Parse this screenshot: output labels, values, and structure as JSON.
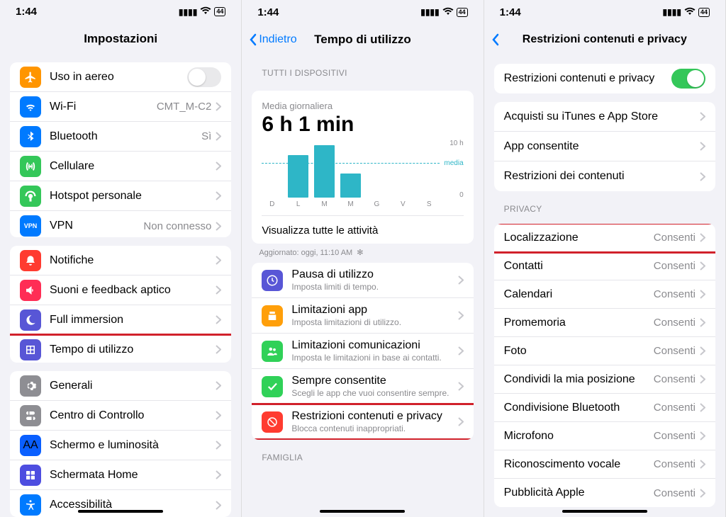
{
  "status": {
    "time": "1:44",
    "battery": "44"
  },
  "screen1": {
    "title": "Impostazioni",
    "g1": [
      {
        "name": "airplane",
        "label": "Uso in aereo",
        "color": "c-orange",
        "toggle": false
      },
      {
        "name": "wifi",
        "label": "Wi-Fi",
        "value": "CMT_M-C2",
        "color": "c-blue"
      },
      {
        "name": "bluetooth",
        "label": "Bluetooth",
        "value": "Sì",
        "color": "c-blue"
      },
      {
        "name": "cellular",
        "label": "Cellulare",
        "color": "c-green"
      },
      {
        "name": "hotspot",
        "label": "Hotspot personale",
        "color": "c-green"
      },
      {
        "name": "vpn",
        "label": "VPN",
        "value": "Non connesso",
        "color": "c-blue",
        "pill": "VPN"
      }
    ],
    "g2": [
      {
        "name": "notifications",
        "label": "Notifiche",
        "color": "c-red"
      },
      {
        "name": "sounds",
        "label": "Suoni e feedback aptico",
        "color": "c-pink"
      },
      {
        "name": "focus",
        "label": "Full immersion",
        "color": "c-indigo"
      },
      {
        "name": "screentime",
        "label": "Tempo di utilizzo",
        "color": "c-indigo",
        "highlight": true
      }
    ],
    "g3": [
      {
        "name": "general",
        "label": "Generali",
        "color": "c-gray"
      },
      {
        "name": "controlcenter",
        "label": "Centro di Controllo",
        "color": "c-gray"
      },
      {
        "name": "display",
        "label": "Schermo e luminosità",
        "color": "c-aa"
      },
      {
        "name": "homescreen",
        "label": "Schermata Home",
        "color": "c-grid"
      },
      {
        "name": "accessibility",
        "label": "Accessibilità",
        "color": "c-blue"
      }
    ]
  },
  "screen2": {
    "back": "Indietro",
    "title": "Tempo di utilizzo",
    "devices_header": "TUTTI I DISPOSITIVI",
    "avg_label": "Media giornaliera",
    "avg_value": "6 h 1 min",
    "view_all": "Visualizza tutte le attività",
    "updated": "Aggiornato: oggi, 11:10 AM",
    "items": [
      {
        "name": "downtime",
        "label": "Pausa di utilizzo",
        "sub": "Imposta limiti di tempo.",
        "color": "c-indigo"
      },
      {
        "name": "applimits",
        "label": "Limitazioni app",
        "sub": "Imposta limitazioni di utilizzo.",
        "color": "c-sand"
      },
      {
        "name": "commlimits",
        "label": "Limitazioni comunicazioni",
        "sub": "Imposta le limitazioni in base ai contatti.",
        "color": "c-green2"
      },
      {
        "name": "alwaysallowed",
        "label": "Sempre consentite",
        "sub": "Scegli le app che vuoi consentire sempre.",
        "color": "c-green2"
      },
      {
        "name": "restrictions",
        "label": "Restrizioni contenuti e privacy",
        "sub": "Blocca contenuti inappropriati.",
        "color": "c-red",
        "highlight": true
      }
    ],
    "family_header": "FAMIGLIA"
  },
  "screen3": {
    "title": "Restrizioni contenuti e privacy",
    "main_toggle_label": "Restrizioni contenuti e privacy",
    "g1": [
      {
        "name": "itunes",
        "label": "Acquisti su iTunes e App Store"
      },
      {
        "name": "allowedapps",
        "label": "App consentite"
      },
      {
        "name": "contentrestrict",
        "label": "Restrizioni dei contenuti"
      }
    ],
    "privacy_header": "PRIVACY",
    "g2": [
      {
        "name": "location",
        "label": "Localizzazione",
        "value": "Consenti",
        "highlight": true
      },
      {
        "name": "contacts",
        "label": "Contatti",
        "value": "Consenti"
      },
      {
        "name": "calendars",
        "label": "Calendari",
        "value": "Consenti"
      },
      {
        "name": "reminders",
        "label": "Promemoria",
        "value": "Consenti"
      },
      {
        "name": "photos",
        "label": "Foto",
        "value": "Consenti"
      },
      {
        "name": "sharelocation",
        "label": "Condividi la mia posizione",
        "value": "Consenti"
      },
      {
        "name": "btshare",
        "label": "Condivisione Bluetooth",
        "value": "Consenti"
      },
      {
        "name": "microphone",
        "label": "Microfono",
        "value": "Consenti"
      },
      {
        "name": "speech",
        "label": "Riconoscimento vocale",
        "value": "Consenti"
      },
      {
        "name": "appleads",
        "label": "Pubblicità Apple",
        "value": "Consenti"
      }
    ]
  },
  "chart_data": {
    "type": "bar",
    "categories": [
      "D",
      "L",
      "M",
      "M",
      "G",
      "V",
      "S"
    ],
    "values": [
      0,
      7.5,
      9.3,
      4.2,
      0,
      0,
      0
    ],
    "title": "Media giornaliera",
    "value_label": "6 h 1 min",
    "ylabel": "h",
    "ylim": [
      0,
      10
    ],
    "ytick_top": "10 h",
    "ytick_bottom": "0",
    "media_label": "media",
    "media_value": 6.0
  }
}
